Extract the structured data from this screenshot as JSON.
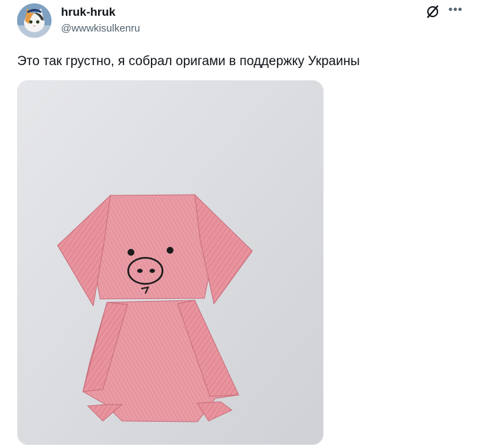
{
  "author": {
    "display_name": "hruk-hruk",
    "handle": "@wwwkisulkenru"
  },
  "actions": {
    "grok_icon": "grok-slash-icon",
    "more_icon": "more-horizontal-icon"
  },
  "tweet": {
    "text": "Это так грустно, я собрал оригами в поддержку Украины"
  },
  "media": {
    "subject": "origami-pig-photo"
  },
  "colors": {
    "text": "#0f1419",
    "secondary": "#536471",
    "paper_pink": "#e6909a"
  }
}
